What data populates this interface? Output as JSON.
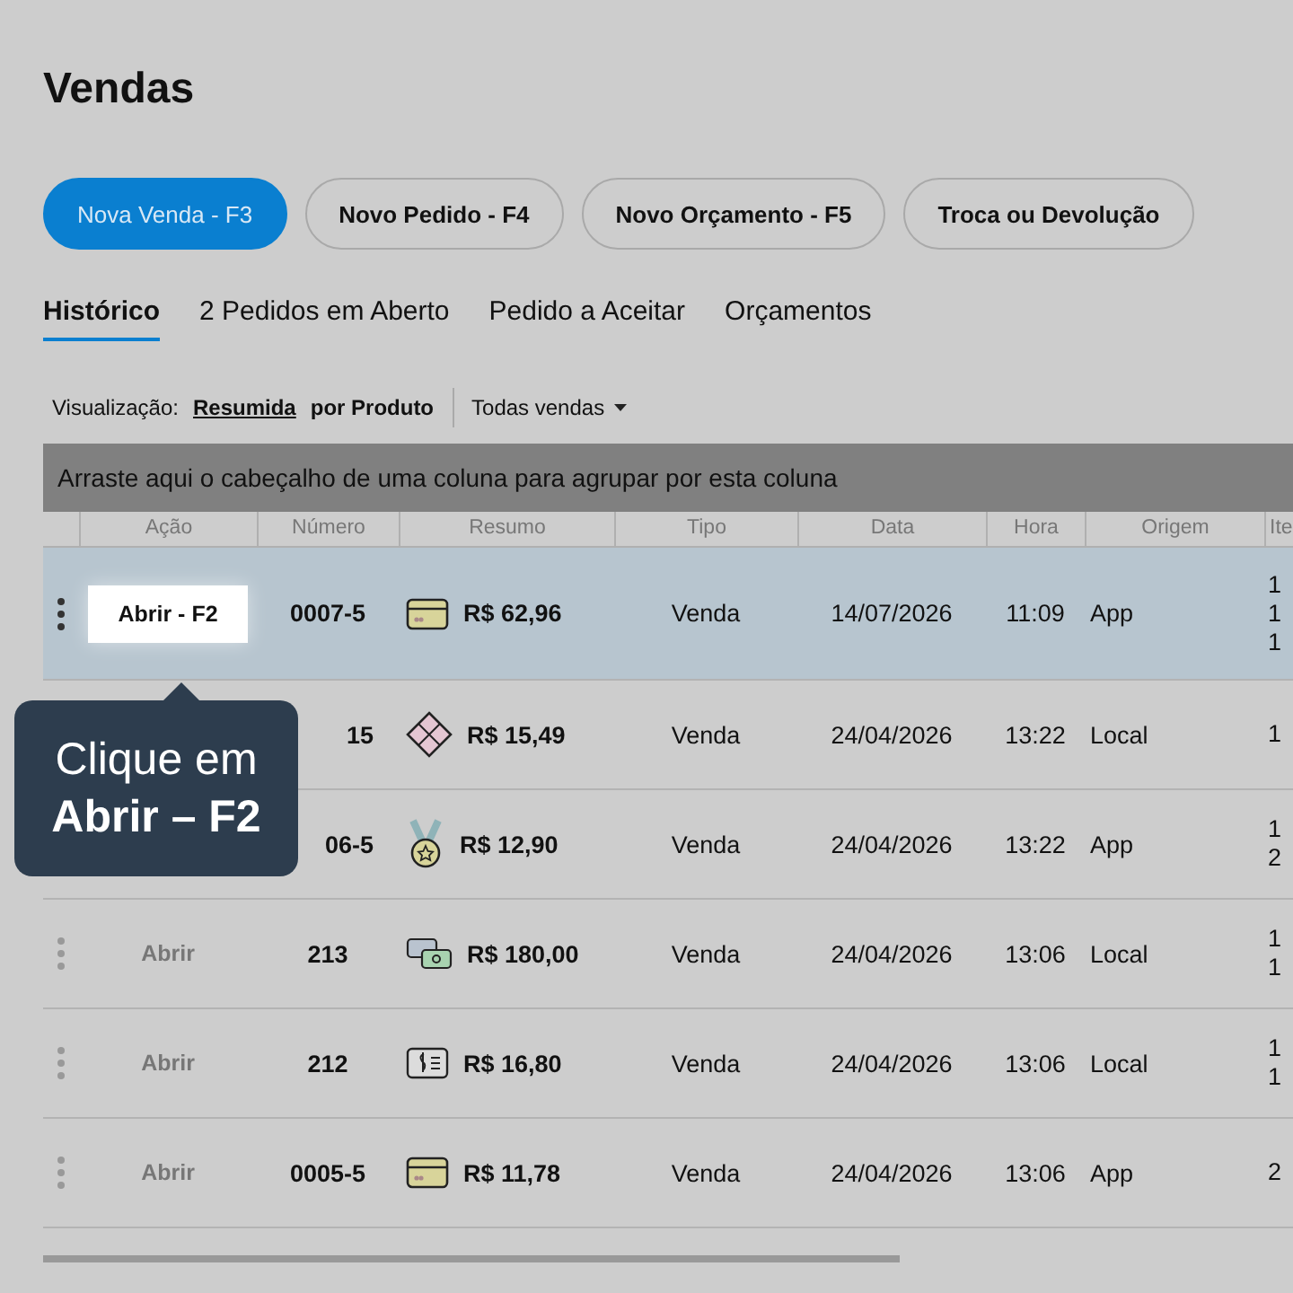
{
  "page": {
    "title": "Vendas"
  },
  "actions": [
    {
      "label": "Nova Venda - F3",
      "primary": true
    },
    {
      "label": "Novo Pedido - F4",
      "primary": false
    },
    {
      "label": "Novo Orçamento - F5",
      "primary": false
    },
    {
      "label": "Troca ou Devolução",
      "primary": false
    }
  ],
  "tabs": [
    {
      "label": "Histórico",
      "selected": true
    },
    {
      "label": "2 Pedidos em Aberto",
      "selected": false
    },
    {
      "label": "Pedido a Aceitar",
      "selected": false
    },
    {
      "label": "Orçamentos",
      "selected": false
    }
  ],
  "view": {
    "label": "Visualização:",
    "options": [
      {
        "label": "Resumida",
        "selected": true
      },
      {
        "label": "por Produto",
        "selected": false
      }
    ],
    "filter": "Todas vendas"
  },
  "table": {
    "group_hint": "Arraste aqui o cabeçalho de uma coluna para agrupar por esta coluna",
    "columns": [
      "Ação",
      "Número",
      "Resumo",
      "Tipo",
      "Data",
      "Hora",
      "Origem",
      "Ite"
    ],
    "rows": [
      {
        "selected": true,
        "action": "Abrir - F2",
        "number": "0007-5",
        "kind": "card",
        "total": "R$ 62,96",
        "type": "Venda",
        "date": "14/07/2026",
        "time": "11:09",
        "origin": "App",
        "items": [
          "1",
          "1",
          "1"
        ]
      },
      {
        "selected": false,
        "number": "15",
        "kind": "diamond",
        "total": "R$ 15,49",
        "type": "Venda",
        "date": "24/04/2026",
        "time": "13:22",
        "origin": "Local",
        "items": [
          "1"
        ]
      },
      {
        "selected": false,
        "number": "06-5",
        "kind": "medal",
        "total": "R$ 12,90",
        "type": "Venda",
        "date": "24/04/2026",
        "time": "13:22",
        "origin": "App",
        "items": [
          "1",
          "2"
        ]
      },
      {
        "selected": false,
        "action": "Abrir",
        "number": "213",
        "kind": "cash",
        "total": "R$ 180,00",
        "type": "Venda",
        "date": "24/04/2026",
        "time": "13:06",
        "origin": "Local",
        "items": [
          "1",
          "1"
        ]
      },
      {
        "selected": false,
        "action": "Abrir",
        "number": "212",
        "kind": "bill",
        "total": "R$ 16,80",
        "type": "Venda",
        "date": "24/04/2026",
        "time": "13:06",
        "origin": "Local",
        "items": [
          "1",
          "1"
        ]
      },
      {
        "selected": false,
        "action": "Abrir",
        "number": "0005-5",
        "kind": "card",
        "total": "R$ 11,78",
        "type": "Venda",
        "date": "24/04/2026",
        "time": "13:06",
        "origin": "App",
        "items": [
          "2"
        ]
      }
    ]
  },
  "tooltip": {
    "text": "Clique em",
    "emphasis": "Abrir – F2"
  }
}
